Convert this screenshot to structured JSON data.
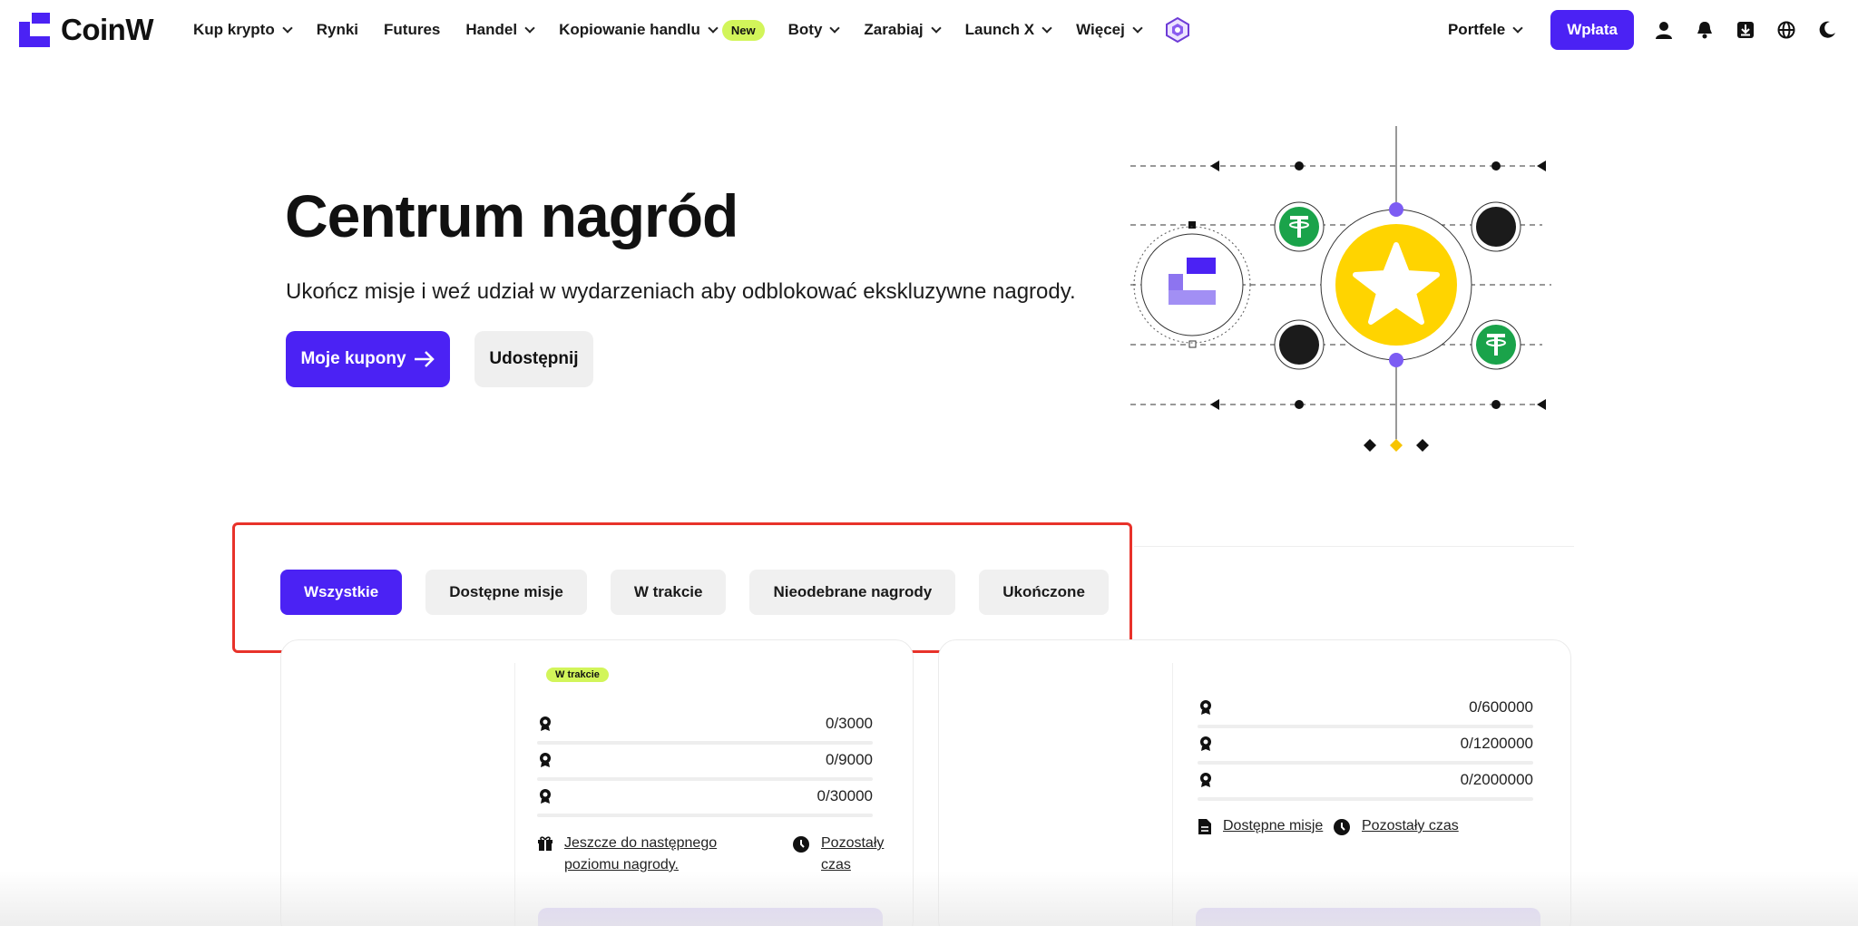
{
  "brand": {
    "name": "CoinW",
    "accent": "#4b22f4",
    "lime": "#d2f55a"
  },
  "nav": {
    "items": [
      {
        "label": "Kup krypto",
        "dropdown": true
      },
      {
        "label": "Rynki",
        "dropdown": false
      },
      {
        "label": "Futures",
        "dropdown": false
      },
      {
        "label": "Handel",
        "dropdown": true
      },
      {
        "label": "Kopiowanie handlu",
        "dropdown": true,
        "badge": "New"
      },
      {
        "label": "Boty",
        "dropdown": true
      },
      {
        "label": "Zarabiaj",
        "dropdown": true
      },
      {
        "label": "Launch X",
        "dropdown": true
      },
      {
        "label": "Więcej",
        "dropdown": true
      }
    ],
    "wallets_label": "Portfele",
    "deposit_label": "Wpłata",
    "icons": [
      "user-icon",
      "bell-icon",
      "download-icon",
      "globe-icon",
      "moon-icon"
    ]
  },
  "hero": {
    "title": "Centrum nagród",
    "subtitle": "Ukończ misje i weź udział w wydarzeniach aby odblokować ekskluzywne nagrody.",
    "primary_button": "Moje kupony",
    "secondary_button": "Udostępnij"
  },
  "tabs": [
    {
      "label": "Wszystkie",
      "active": true
    },
    {
      "label": "Dostępne misje",
      "active": false
    },
    {
      "label": "W trakcie",
      "active": false
    },
    {
      "label": "Nieodebrane nagrody",
      "active": false
    },
    {
      "label": "Ukończone",
      "active": false
    }
  ],
  "cards": [
    {
      "status": "W trakcie",
      "levels": [
        "0/3000",
        "0/9000",
        "0/30000"
      ],
      "link_left": "Jeszcze do następnego poziomu nagrody.",
      "link_right": "Pozostały czas"
    },
    {
      "levels": [
        "0/600000",
        "0/1200000",
        "0/2000000"
      ],
      "link_left": "Dostępne misje",
      "link_right": "Pozostały czas"
    }
  ]
}
